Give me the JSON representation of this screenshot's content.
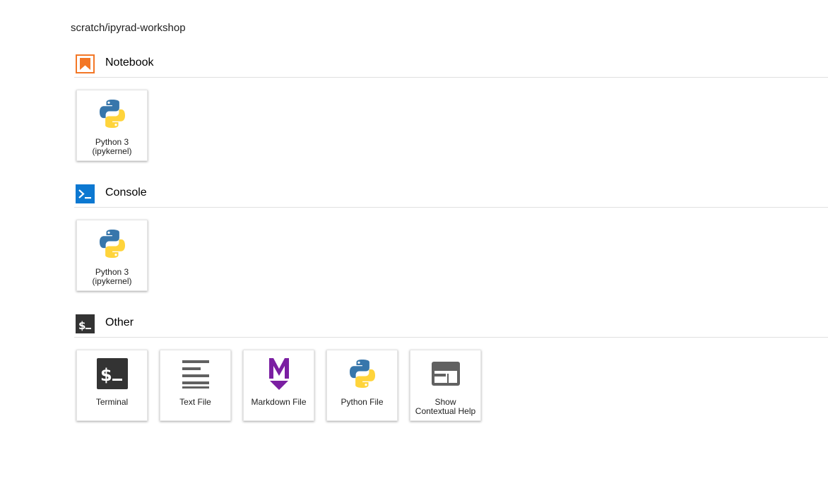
{
  "cwd": "scratch/ipyrad-workshop",
  "sections": {
    "notebook": {
      "title": "Notebook",
      "cards": [
        {
          "label": "Python 3\n(ipykernel)",
          "icon": "python-logo-icon"
        }
      ]
    },
    "console": {
      "title": "Console",
      "cards": [
        {
          "label": "Python 3\n(ipykernel)",
          "icon": "python-logo-icon"
        }
      ]
    },
    "other": {
      "title": "Other",
      "cards": [
        {
          "label": "Terminal",
          "icon": "terminal-icon"
        },
        {
          "label": "Text File",
          "icon": "text-file-icon"
        },
        {
          "label": "Markdown File",
          "icon": "markdown-icon"
        },
        {
          "label": "Python File",
          "icon": "python-logo-icon"
        },
        {
          "label": "Show\nContextual Help",
          "icon": "contextual-help-icon"
        }
      ]
    }
  },
  "colors": {
    "notebook_accent": "#f37726",
    "console_accent": "#0c78d1",
    "terminal_bg": "#333333",
    "markdown_purple": "#7b1fa2",
    "python_blue": "#3776ab",
    "python_yellow": "#ffd43b"
  }
}
